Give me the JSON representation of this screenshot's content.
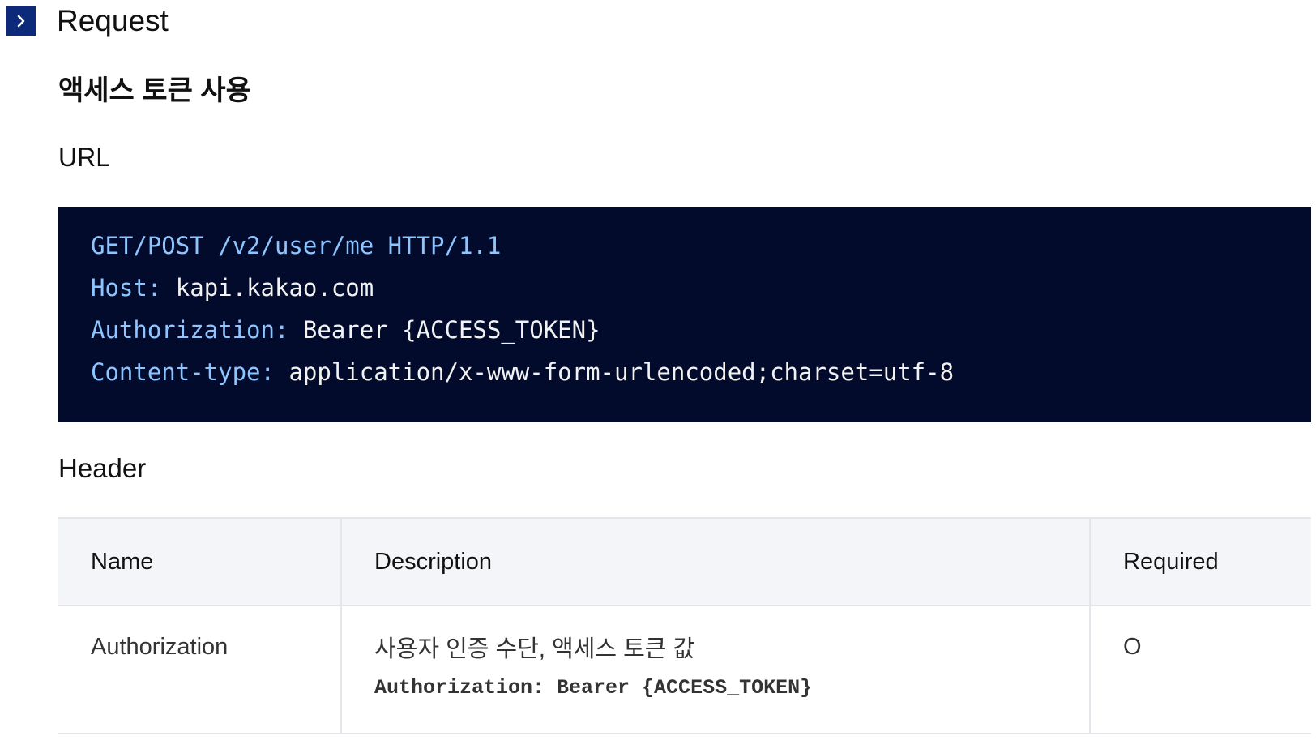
{
  "section": {
    "title": "Request",
    "toggle_icon": "chevron-right-icon",
    "toggle_color": "#0d2a7a"
  },
  "subtitle": "액세스 토큰 사용",
  "url": {
    "title": "URL",
    "code_bg": "#030b2c",
    "keyword_color": "#8ec5ff",
    "lines": [
      {
        "key": "GET/POST /v2/user/me HTTP/1.1",
        "value": ""
      },
      {
        "key": "Host:",
        "value": " kapi.kakao.com"
      },
      {
        "key": "Authorization:",
        "value": " Bearer {ACCESS_TOKEN}"
      },
      {
        "key": "Content-type:",
        "value": " application/x-www-form-urlencoded;charset=utf-8"
      }
    ]
  },
  "header": {
    "title": "Header",
    "columns": [
      "Name",
      "Description",
      "Required"
    ],
    "rows": [
      {
        "name": "Authorization",
        "description": "사용자 인증 수단, 액세스 토큰 값",
        "description_code": "Authorization: Bearer {ACCESS_TOKEN}",
        "required": "O"
      }
    ]
  }
}
